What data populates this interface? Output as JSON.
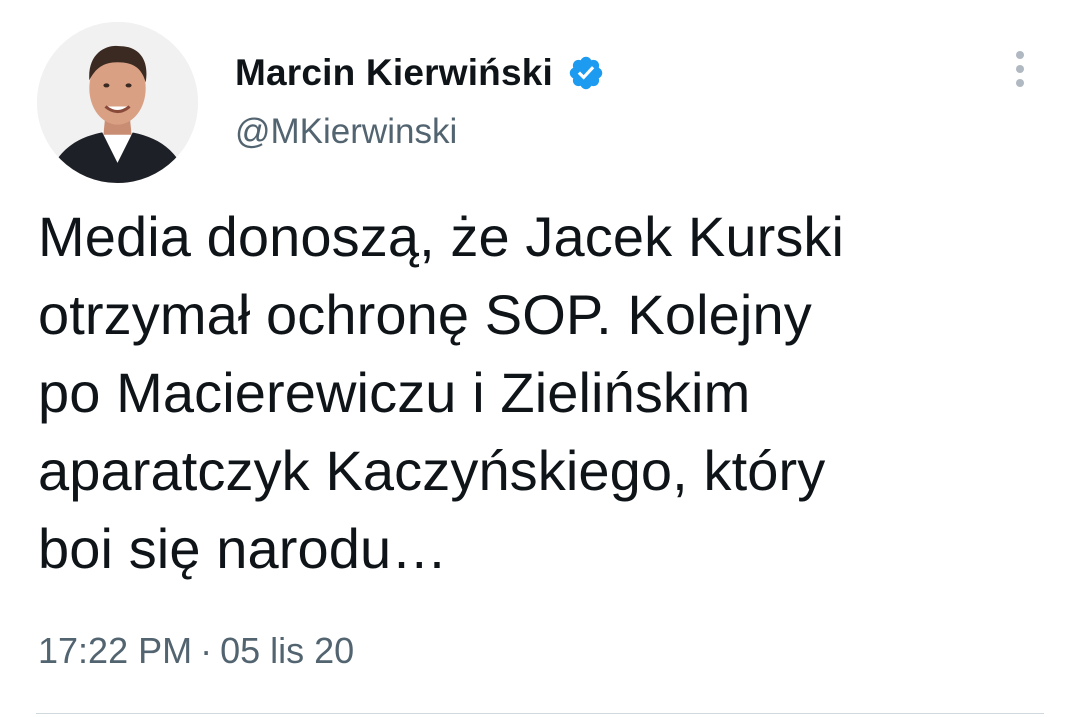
{
  "author": {
    "display_name": "Marcin Kierwiński",
    "handle": "@MKierwinski",
    "verified": true,
    "verified_icon": "verified-badge-icon",
    "verified_color": "#1d9bf0"
  },
  "tweet": {
    "text": "Media donoszą, że Jacek Kurski\notrzymał ochronę SOP. Kolejny\npo Macierewiczu i Zielińskim\naparatczyk Kaczyńskiego, który\nboi się narodu…",
    "time": "17:22 PM",
    "separator": "·",
    "date": "05 lis 20"
  },
  "icons": {
    "more": "more-options-icon",
    "avatar": "profile-photo"
  },
  "colors": {
    "text": "#0f1419",
    "secondary": "#536471",
    "divider": "#cfd9de"
  }
}
